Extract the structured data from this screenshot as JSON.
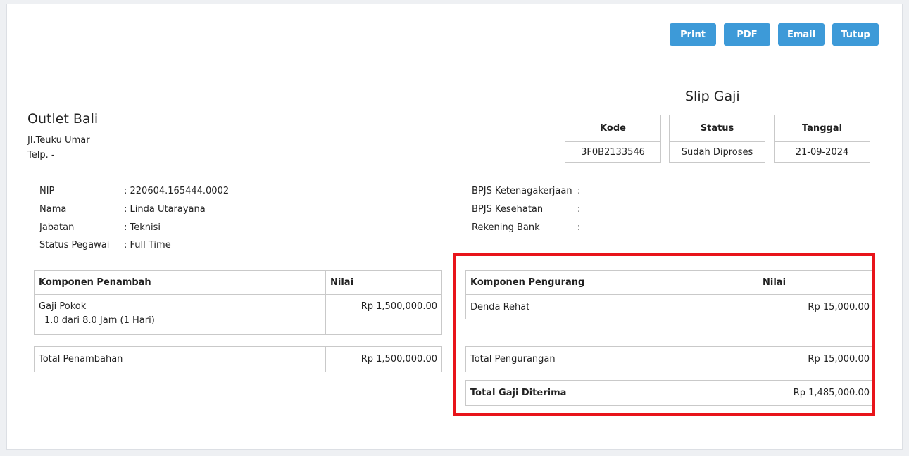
{
  "toolbar": {
    "print_label": "Print",
    "pdf_label": "PDF",
    "email_label": "Email",
    "close_label": "Tutup"
  },
  "outlet": {
    "name": "Outlet Bali",
    "address": "Jl.Teuku Umar",
    "phone": "Telp. -"
  },
  "slip": {
    "title": "Slip Gaji",
    "kode_label": "Kode",
    "kode_value": "3F0B2133546",
    "status_label": "Status",
    "status_value": "Sudah Diproses",
    "tanggal_label": "Tanggal",
    "tanggal_value": "21-09-2024"
  },
  "employee": {
    "nip_label": "NIP",
    "nip_value": ": 220604.165444.0002",
    "nama_label": "Nama",
    "nama_value": ": Linda Utarayana",
    "jabatan_label": "Jabatan",
    "jabatan_value": ": Teknisi",
    "status_label": "Status Pegawai",
    "status_value": ": Full Time",
    "bpjs_tk_label": "BPJS Ketenagakerjaan",
    "bpjs_tk_value": ":",
    "bpjs_kes_label": "BPJS Kesehatan",
    "bpjs_kes_value": ":",
    "rekening_label": "Rekening Bank",
    "rekening_value": ":"
  },
  "penambah": {
    "header_komponen": "Komponen Penambah",
    "header_nilai": "Nilai",
    "item_name": "Gaji Pokok",
    "item_detail": "1.0 dari 8.0 Jam (1 Hari)",
    "item_value": "Rp 1,500,000.00",
    "total_label": "Total Penambahan",
    "total_value": "Rp 1,500,000.00"
  },
  "pengurang": {
    "header_komponen": "Komponen Pengurang",
    "header_nilai": "Nilai",
    "item_name": "Denda Rehat",
    "item_value": "Rp 15,000.00",
    "total_label": "Total Pengurangan",
    "total_value": "Rp 15,000.00",
    "net_label": "Total Gaji Diterima",
    "net_value": "Rp 1,485,000.00"
  },
  "colors": {
    "button": "#3d9ad8",
    "highlight": "#e8141a"
  }
}
